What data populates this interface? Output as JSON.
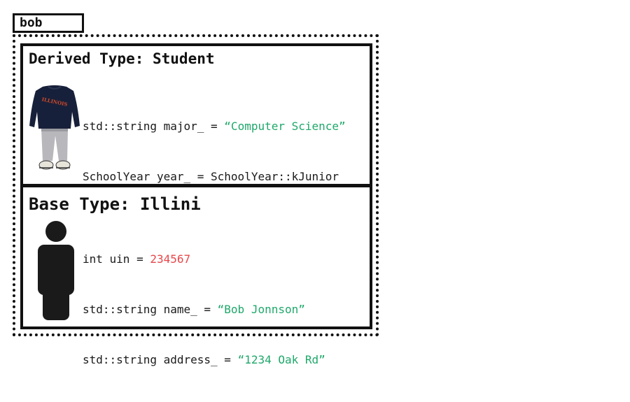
{
  "object_name": "bob",
  "derived": {
    "heading": "Derived Type: Student",
    "fields": [
      {
        "decl": "std::string major_ = ",
        "value": "“Computer Science”",
        "value_color": "#1fa86a"
      },
      {
        "decl": "SchoolYear year_ = SchoolYear::kJunior",
        "value": "",
        "value_color": "#1a1a1a"
      }
    ],
    "figure_icon": "student-outfit-icon",
    "logo_text": "ILLINOIS"
  },
  "base": {
    "heading": "Base Type: Illini",
    "fields": [
      {
        "decl": "int uin = ",
        "value": "234567",
        "value_color": "#e8474a"
      },
      {
        "decl": "std::string name_ = ",
        "value": "“Bob Jonnson”",
        "value_color": "#1fa86a"
      },
      {
        "decl": "std::string address_ = ",
        "value": "“1234 Oak Rd”",
        "value_color": "#1fa86a"
      }
    ],
    "figure_icon": "person-silhouette-icon"
  }
}
